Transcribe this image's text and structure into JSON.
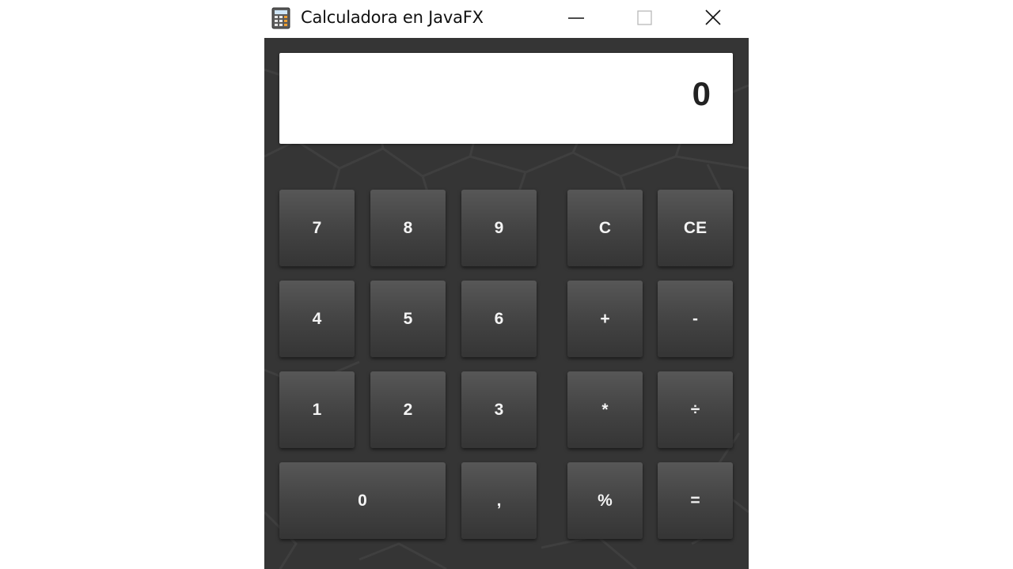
{
  "window": {
    "title": "Calculadora en JavaFX",
    "app_icon": "calculator-icon",
    "controls": {
      "minimize_icon": "minimize-icon",
      "maximize_icon": "maximize-icon",
      "close_icon": "close-icon"
    }
  },
  "display": {
    "value": "0"
  },
  "keypad": {
    "key_7": "7",
    "key_8": "8",
    "key_9": "9",
    "key_c": "C",
    "key_ce": "CE",
    "key_4": "4",
    "key_5": "5",
    "key_6": "6",
    "key_plus": "+",
    "key_minus": "-",
    "key_1": "1",
    "key_2": "2",
    "key_3": "3",
    "key_multiply": "*",
    "key_divide": "÷",
    "key_0": "0",
    "key_comma": ",",
    "key_percent": "%",
    "key_equals": "="
  },
  "colors": {
    "background": "#353535",
    "key_top": "#575757",
    "key_bottom": "#353535",
    "key_text": "#f4f4f4",
    "display_bg": "#ffffff",
    "display_text": "#222222"
  }
}
